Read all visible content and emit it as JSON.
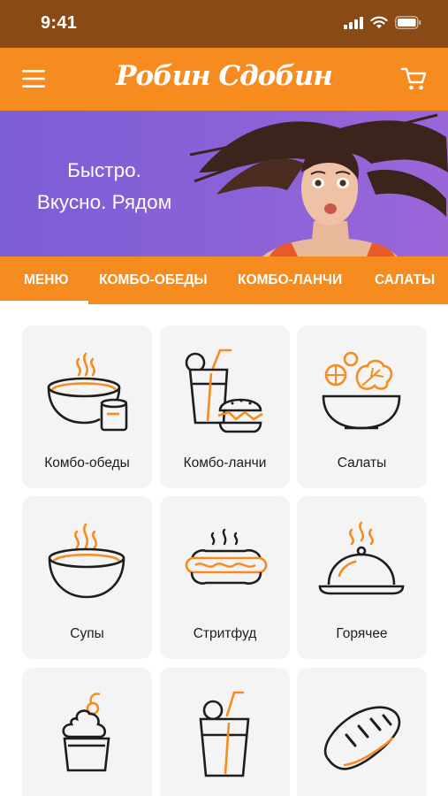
{
  "status_bar": {
    "time": "9:41"
  },
  "header": {
    "logo": "Робин Сдобин"
  },
  "banner": {
    "line1": "Быстро.",
    "line2": "Вкусно. Рядом"
  },
  "tabs": [
    {
      "label": "МЕНЮ",
      "active": true
    },
    {
      "label": "КОМБО-ОБЕДЫ"
    },
    {
      "label": "КОМБО-ЛАНЧИ"
    },
    {
      "label": "САЛАТЫ"
    }
  ],
  "categories": [
    {
      "label": "Комбо-обеды",
      "icon": "soup-cup-icon"
    },
    {
      "label": "Комбо-ланчи",
      "icon": "drink-burger-icon"
    },
    {
      "label": "Салаты",
      "icon": "salad-bowl-icon"
    },
    {
      "label": "Супы",
      "icon": "soup-bowl-icon"
    },
    {
      "label": "Стритфуд",
      "icon": "hotdog-icon"
    },
    {
      "label": "Горячее",
      "icon": "cloche-icon"
    },
    {
      "label": "",
      "icon": "dessert-icon"
    },
    {
      "label": "",
      "icon": "drink-icon"
    },
    {
      "label": "",
      "icon": "bread-icon"
    }
  ],
  "colors": {
    "brand_orange": "#f68b1f",
    "status_brown": "#8a4a15",
    "banner_purple": "#7c5ed6",
    "card_bg": "#f4f4f4"
  }
}
